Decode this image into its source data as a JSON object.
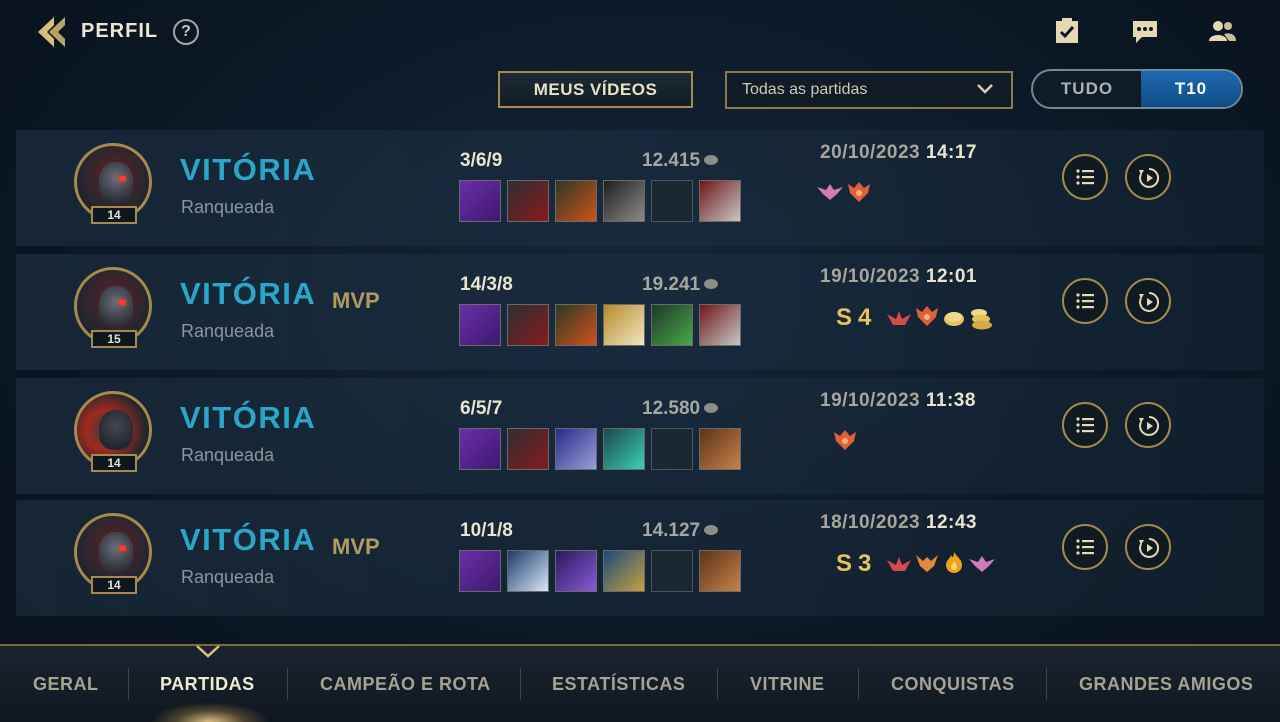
{
  "header": {
    "title": "PERFIL",
    "help": "?",
    "icons": [
      "back-arrow-icon",
      "missions-check-icon",
      "chat-icon",
      "friends-icon"
    ]
  },
  "controls": {
    "videos_button": "MEUS VÍDEOS",
    "filter_value": "Todas as partidas",
    "toggle": {
      "all": "TUDO",
      "t10": "T10",
      "selected": "T10"
    }
  },
  "matches": [
    {
      "result": "VITÓRIA",
      "mvp": "",
      "queue": "Ranqueada",
      "level": "14",
      "kda": "3/6/9",
      "gold": "12.415",
      "date": "20/10/2023",
      "time": "14:17",
      "badge_letters": [],
      "badges": [
        "winged-emblem-icon",
        "dragon-flame-icon"
      ]
    },
    {
      "result": "VITÓRIA",
      "mvp": "MVP",
      "queue": "Ranqueada",
      "level": "15",
      "kda": "14/3/8",
      "gold": "19.241",
      "date": "19/10/2023",
      "time": "12:01",
      "badge_letters": [
        "S",
        "4"
      ],
      "badges": [
        "lotus-icon",
        "dragon-flame-icon",
        "coin-icon",
        "coin-stack-icon"
      ]
    },
    {
      "result": "VITÓRIA",
      "mvp": "",
      "queue": "Ranqueada",
      "level": "14",
      "kda": "6/5/7",
      "gold": "12.580",
      "date": "19/10/2023",
      "time": "11:38",
      "badge_letters": [],
      "badges": [
        "dragon-flame-icon"
      ]
    },
    {
      "result": "VITÓRIA",
      "mvp": "MVP",
      "queue": "Ranqueada",
      "level": "14",
      "kda": "10/1/8",
      "gold": "14.127",
      "date": "18/10/2023",
      "time": "12:43",
      "badge_letters": [
        "S",
        "3"
      ],
      "badges": [
        "lotus-icon",
        "horned-crest-icon",
        "flame-icon",
        "winged-emblem-icon"
      ]
    }
  ],
  "row_buttons": {
    "details_icon": "list-icon",
    "replay_icon": "replay-play-icon"
  },
  "nav": {
    "tabs": [
      "GERAL",
      "PARTIDAS",
      "CAMPEÃO E ROTA",
      "ESTATÍSTICAS",
      "VITRINE",
      "CONQUISTAS",
      "GRANDES AMIGOS"
    ],
    "active": "PARTIDAS"
  },
  "colors": {
    "victory": "#2aa6c8",
    "gold_accent": "#a48a4c",
    "mvp": "#b39a5e",
    "active_toggle": "#1e6ab0"
  }
}
